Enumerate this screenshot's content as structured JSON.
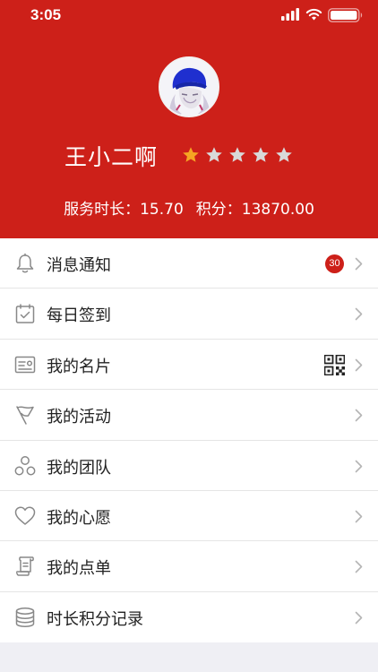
{
  "status_bar": {
    "time": "3:05"
  },
  "profile": {
    "name": "王小二啊",
    "rating": 1,
    "max_rating": 5,
    "star_active_color": "#f5a623",
    "star_inactive_color": "#d9d9d9",
    "service_label": "服务时长：",
    "service_value": "15.70",
    "points_label": "积分：",
    "points_value": "13870.00"
  },
  "theme": {
    "primary": "#cd2019"
  },
  "menu": {
    "items": [
      {
        "label": "消息通知",
        "icon": "bell-icon",
        "badge": "30"
      },
      {
        "label": "每日签到",
        "icon": "calendar-check-icon"
      },
      {
        "label": "我的名片",
        "icon": "id-card-icon",
        "extra_icon": "qr-code-icon"
      },
      {
        "label": "我的活动",
        "icon": "flag-icon"
      },
      {
        "label": "我的团队",
        "icon": "team-icon"
      },
      {
        "label": "我的心愿",
        "icon": "heart-icon"
      },
      {
        "label": "我的点单",
        "icon": "scroll-icon"
      },
      {
        "label": "时长积分记录",
        "icon": "database-icon"
      }
    ]
  }
}
